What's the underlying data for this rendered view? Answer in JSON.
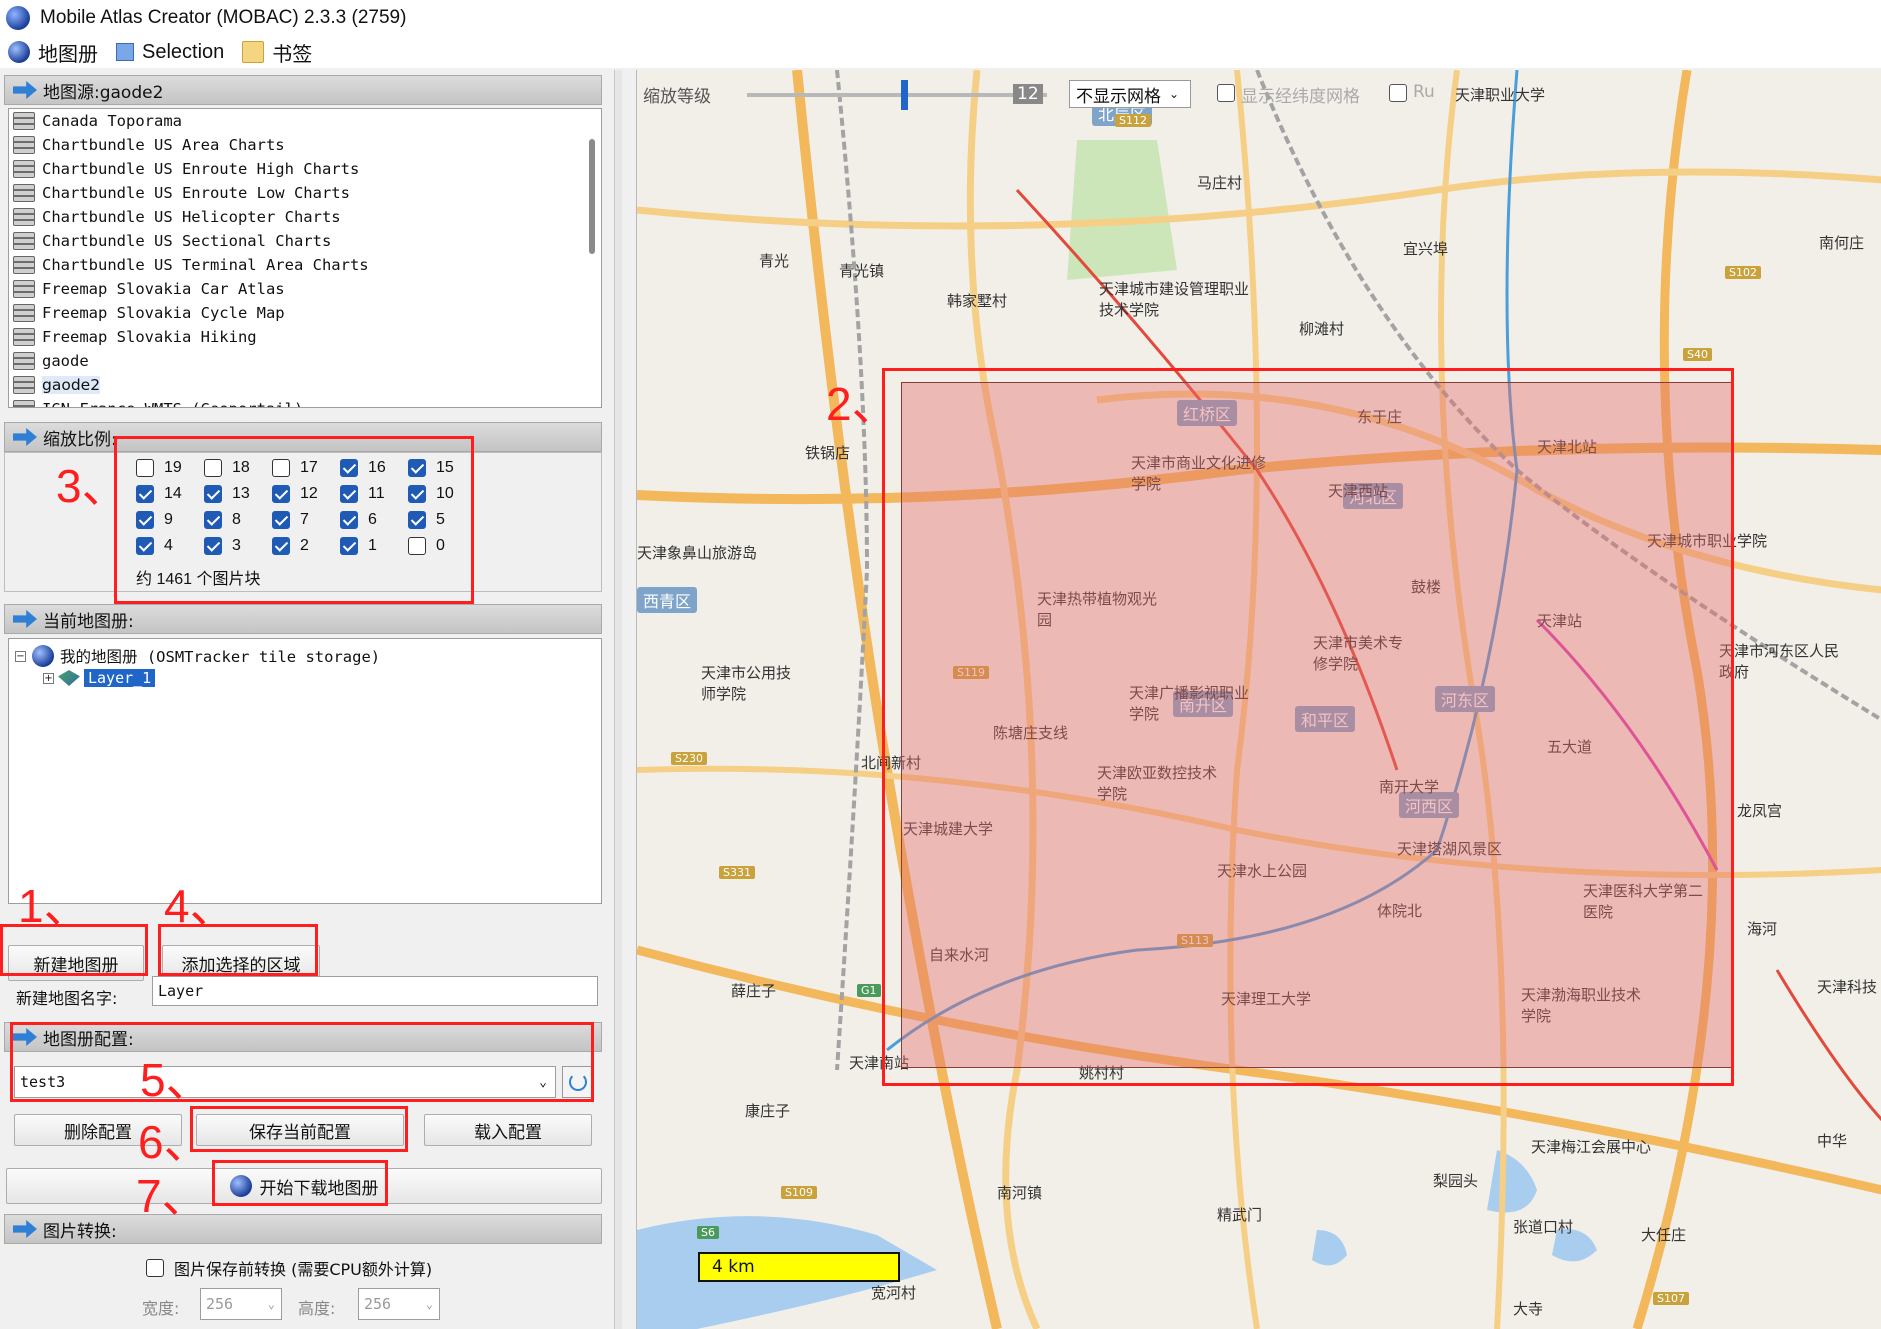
{
  "window": {
    "title": "Mobile Atlas Creator (MOBAC) 2.3.3 (2759)"
  },
  "menu": [
    {
      "label": "地图册",
      "icon": "globe-icon"
    },
    {
      "label": "Selection",
      "icon": "selection-icon"
    },
    {
      "label": "书签",
      "icon": "bookmark-icon"
    }
  ],
  "map_source": {
    "header": "地图源:gaode2",
    "items": [
      "Canada Toporama",
      "Chartbundle US Area Charts",
      "Chartbundle US Enroute High Charts",
      "Chartbundle US Enroute Low Charts",
      "Chartbundle US Helicopter Charts",
      "Chartbundle US Sectional Charts",
      "Chartbundle US Terminal Area Charts",
      "Freemap Slovakia Car Atlas",
      "Freemap Slovakia Cycle Map",
      "Freemap Slovakia Hiking",
      "gaode",
      "gaode2",
      "IGN France WMTS (Geoportail)"
    ],
    "selected": "gaode2"
  },
  "zoom_levels": {
    "header": "缩放比例:",
    "levels": [
      {
        "label": "19",
        "checked": false
      },
      {
        "label": "18",
        "checked": false
      },
      {
        "label": "17",
        "checked": false
      },
      {
        "label": "16",
        "checked": true
      },
      {
        "label": "15",
        "checked": true
      },
      {
        "label": "14",
        "checked": true
      },
      {
        "label": "13",
        "checked": true
      },
      {
        "label": "12",
        "checked": true
      },
      {
        "label": "11",
        "checked": true
      },
      {
        "label": "10",
        "checked": true
      },
      {
        "label": "9",
        "checked": true
      },
      {
        "label": "8",
        "checked": true
      },
      {
        "label": "7",
        "checked": true
      },
      {
        "label": "6",
        "checked": true
      },
      {
        "label": "5",
        "checked": true
      },
      {
        "label": "4",
        "checked": true
      },
      {
        "label": "3",
        "checked": true
      },
      {
        "label": "2",
        "checked": true
      },
      {
        "label": "1",
        "checked": true
      },
      {
        "label": "0",
        "checked": false
      }
    ],
    "tile_count": "约 1461 个图片块"
  },
  "current_atlas": {
    "header": "当前地图册:",
    "root_label": "我的地图册 (OSMTracker tile storage)",
    "layer_label": "Layer_1",
    "new_atlas_button": "新建地图册",
    "add_selection_button": "添加选择的区域",
    "name_label": "新建地图名字:",
    "name_value": "Layer"
  },
  "profile": {
    "header": "地图册配置:",
    "selected": "test3",
    "delete_button": "删除配置",
    "save_button": "保存当前配置",
    "load_button": "载入配置",
    "start_button": "开始下载地图册"
  },
  "tile_conversion": {
    "header": "图片转换:",
    "checkbox_label": "图片保存前转换 (需要CPU额外计算)",
    "width_label": "宽度:",
    "width_value": "256",
    "height_label": "高度:",
    "height_value": "256"
  },
  "annotations": [
    "1、",
    "2、",
    "3、",
    "4、",
    "5、",
    "6、",
    "7、"
  ],
  "map": {
    "zoom_label": "缩放等级",
    "zoom_value": "12",
    "grid_select": "不显示网格",
    "latlon_grid_label": "显示经纬度网格",
    "ruler_label": "Ru",
    "scale_label": "4 km",
    "districts": [
      "北辰区",
      "红桥区",
      "河北区",
      "南开区",
      "和平区",
      "河东区",
      "河西区",
      "西青区"
    ],
    "places": [
      "马庄村",
      "青光",
      "青光镇",
      "韩家墅村",
      "天津城市建设管理职业技术学院",
      "柳滩村",
      "宜兴埠",
      "南何庄",
      "天津职业大学",
      "铁锅店",
      "天津市商业文化进修学院",
      "天津西站",
      "天津北站",
      "东于庄",
      "天津城市职业学院",
      "天津象鼻山旅游岛",
      "天津热带植物观光园",
      "鼓楼",
      "天津站",
      "天津市河东区人民政府",
      "天津市公用技师学院",
      "天津市美术专修学院",
      "天津广播影视职业学院",
      "陈塘庄支线",
      "五大道",
      "北闸新村",
      "天津欧亚数控技术学院",
      "南开大学",
      "龙凤宫",
      "天津城建大学",
      "天津塔湖风景区",
      "天津水上公园",
      "天津医科大学第二医院",
      "体院北",
      "自来水河",
      "薛庄子",
      "天津理工大学",
      "天津渤海职业技术学院",
      "天津南站",
      "姚村村",
      "康庄子",
      "天津梅江会展中心",
      "南河镇",
      "梨园头",
      "精武门",
      "张道口村",
      "大任庄",
      "宽河村",
      "大寺",
      "海河",
      "天津科技",
      "中华"
    ],
    "road_tags": [
      "S112",
      "S102",
      "S40",
      "S119",
      "S230",
      "S331",
      "S113",
      "G1",
      "S109",
      "S6",
      "S107"
    ]
  },
  "colors": {
    "annotation": "#ff1e1e",
    "selection_fill": "#e46e6e",
    "accent": "#1f5bb5"
  }
}
